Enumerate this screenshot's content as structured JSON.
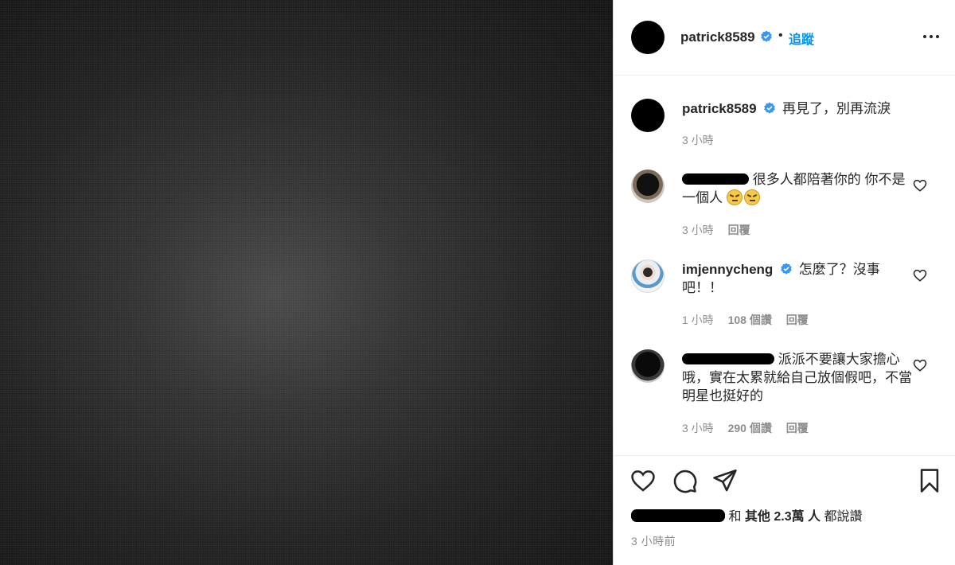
{
  "post": {
    "username": "patrick8589",
    "follow_label": "追蹤",
    "dot": "•"
  },
  "caption": {
    "username": "patrick8589",
    "text": "再見了，別再流淚",
    "time": "3 小時"
  },
  "comments": [
    {
      "username": "",
      "text": "很多人都陪著你的 你不是一個人",
      "time": "3 小時",
      "reply_label": "回覆"
    },
    {
      "username": "imjennycheng",
      "text": "怎麼了？沒事吧！！",
      "time": "1 小時",
      "likes": "108 個讚",
      "reply_label": "回覆"
    },
    {
      "username": "",
      "text": "派派不要讓大家擔心哦，實在太累就給自己放個假吧，不當明星也挺好的",
      "time": "3 小時",
      "likes": "290 個讚",
      "reply_label": "回覆"
    }
  ],
  "likes_line": {
    "connector": "和",
    "others": "其他 2.3萬 人",
    "suffix": "都說讚"
  },
  "posted_time": "3 小時前",
  "colors": {
    "accent": "#0095f6",
    "verified": "#3897f0",
    "muted": "#8e8e8e",
    "text": "#262626"
  },
  "icons": [
    "verified-badge-icon",
    "more-options-icon",
    "heart-icon",
    "comment-icon",
    "share-icon",
    "bookmark-icon",
    "angry-face-emoji"
  ]
}
